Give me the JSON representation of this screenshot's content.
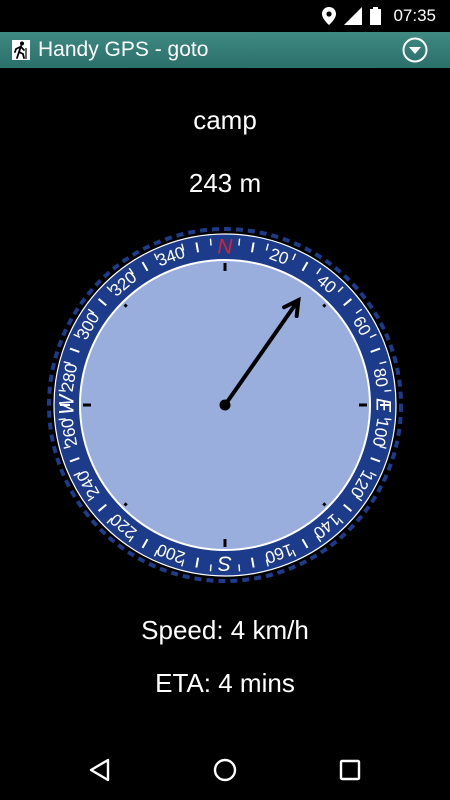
{
  "status_bar": {
    "time": "07:35",
    "icons": [
      "location-icon",
      "signal-icon",
      "battery-icon"
    ]
  },
  "action_bar": {
    "title": "Handy GPS - goto",
    "app_icon": "hiker-icon",
    "menu_icon": "chevron-down-circle-icon",
    "color": "#2f7a74"
  },
  "destination": "camp",
  "distance": "243 m",
  "compass": {
    "bearing_deg": 35,
    "labels": {
      "north": "N",
      "east": "E",
      "south": "S",
      "west": "W",
      "degrees": [
        "20",
        "40",
        "60",
        "80",
        "100",
        "120",
        "140",
        "160",
        "200",
        "220",
        "240",
        "260",
        "280",
        "300",
        "320",
        "340"
      ]
    },
    "dial_color": "#9aaede",
    "bezel_color": "#1d3b8b",
    "north_color": "#d8232a"
  },
  "speed": "Speed: 4 km/h",
  "eta": "ETA: 4 mins",
  "nav": {
    "back": "back-icon",
    "home": "home-icon",
    "recents": "recents-icon"
  }
}
